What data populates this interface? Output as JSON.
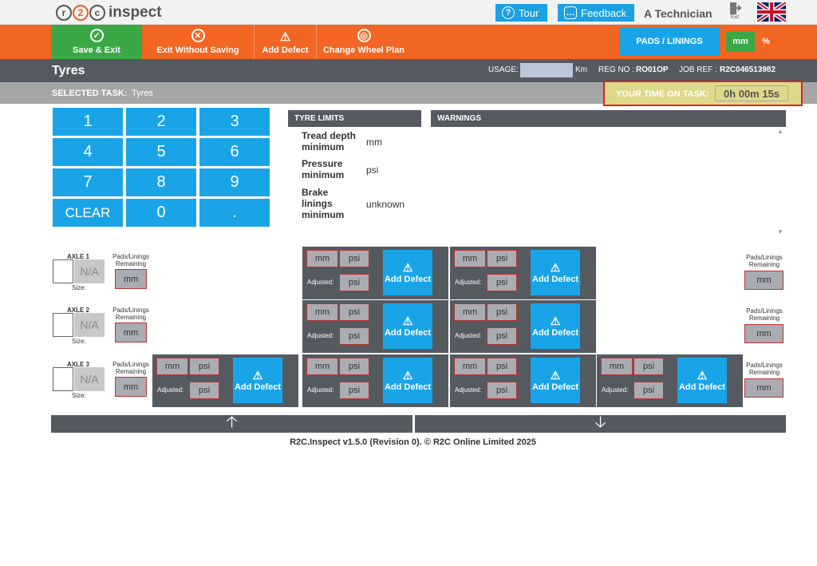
{
  "app": {
    "logo_r": "r",
    "logo_2": "2",
    "logo_c": "c",
    "logo_text": "inspect"
  },
  "top": {
    "tour": "Tour",
    "feedback": "Feedback",
    "user": "A Technician",
    "exit": "Exit"
  },
  "actions": {
    "save": "Save & Exit",
    "exit_nosave": "Exit Without Saving",
    "add_defect": "Add Defect",
    "change_plan": "Change Wheel Plan",
    "pads": "PADS / LININGS",
    "unit_mm": "mm",
    "unit_pct": "%"
  },
  "title": {
    "page": "Tyres",
    "usage_label": "USAGE:",
    "usage_value": "",
    "usage_unit": "Km",
    "reg_label": "REG NO :",
    "reg_value": "RO01OP",
    "job_label": "JOB REF :",
    "job_value": "R2C046513982"
  },
  "task": {
    "label": "SELECTED TASK:",
    "value": "Tyres",
    "time_label": "YOUR TIME ON TASK:",
    "time_value": "0h 00m 15s"
  },
  "keypad": [
    "1",
    "2",
    "3",
    "4",
    "5",
    "6",
    "7",
    "8",
    "9",
    "CLEAR",
    "0",
    "."
  ],
  "limits": {
    "head": "TYRE LIMITS",
    "rows": [
      {
        "l1": "Tread depth",
        "l2": "minimum",
        "v": "mm"
      },
      {
        "l1": "Pressure",
        "l2": "minimum",
        "v": "psi"
      },
      {
        "l1": "Brake",
        "l2": "linings",
        "l3": "minimum",
        "v": "unknown"
      }
    ]
  },
  "warnings": {
    "head": "WARNINGS"
  },
  "axles": [
    {
      "name": "AXLE 1",
      "na": "N/A",
      "size": "Size:"
    },
    {
      "name": "AXLE 2",
      "na": "N/A",
      "size": "Size:"
    },
    {
      "name": "AXLE 3",
      "na": "N/A",
      "size": "Size:"
    }
  ],
  "pads_label1": "Pads/Linings",
  "pads_label2": "Remaining",
  "pads_unit": "mm",
  "tyre": {
    "mm": "mm",
    "psi": "psi",
    "adjusted": "Adjusted:",
    "defect": "Add Defect"
  },
  "footer": "R2C.Inspect v1.5.0 (Revision 0). © R2C Online Limited 2025",
  "nav": {
    "up": "🡡",
    "down": "🡣"
  }
}
